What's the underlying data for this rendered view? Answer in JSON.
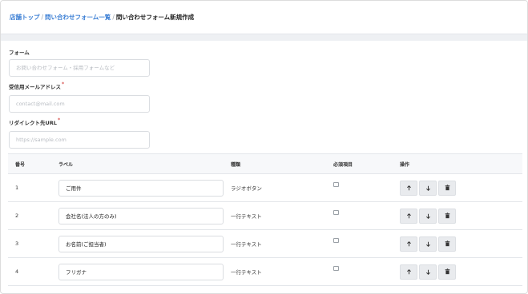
{
  "breadcrumb": {
    "home": "店舗トップ",
    "list": "問い合わせフォーム一覧",
    "current": "問い合わせフォーム新規作成",
    "separator": "/"
  },
  "form": {
    "name_label": "フォーム",
    "name_placeholder": "お問い合わせフォーム・採用フォームなど",
    "email_label": "受信用メールアドレス",
    "email_placeholder": "contact@mail.com",
    "redirect_label": "リダイレクト先URL",
    "redirect_placeholder": "https://sample.com",
    "required_mark": "*"
  },
  "table": {
    "headers": {
      "number": "番号",
      "label": "ラベル",
      "type": "種類",
      "required": "必須項目",
      "actions": "操作"
    },
    "rows": [
      {
        "number": "1",
        "label": "ご用件",
        "type": "ラジオボタン",
        "required": false
      },
      {
        "number": "2",
        "label": "会社名(法人の方のみ)",
        "type": "一行テキスト",
        "required": false
      },
      {
        "number": "3",
        "label": "お名前(ご担当者)",
        "type": "一行テキスト",
        "required": false
      },
      {
        "number": "4",
        "label": "フリガナ",
        "type": "一行テキスト",
        "required": false
      }
    ]
  },
  "icons": {
    "move_up": "arrow-up-icon",
    "move_down": "arrow-down-icon",
    "delete": "trash-icon"
  },
  "colors": {
    "link": "#3a7ed4",
    "required": "#d9534f",
    "button_bg": "#e9ebee"
  }
}
